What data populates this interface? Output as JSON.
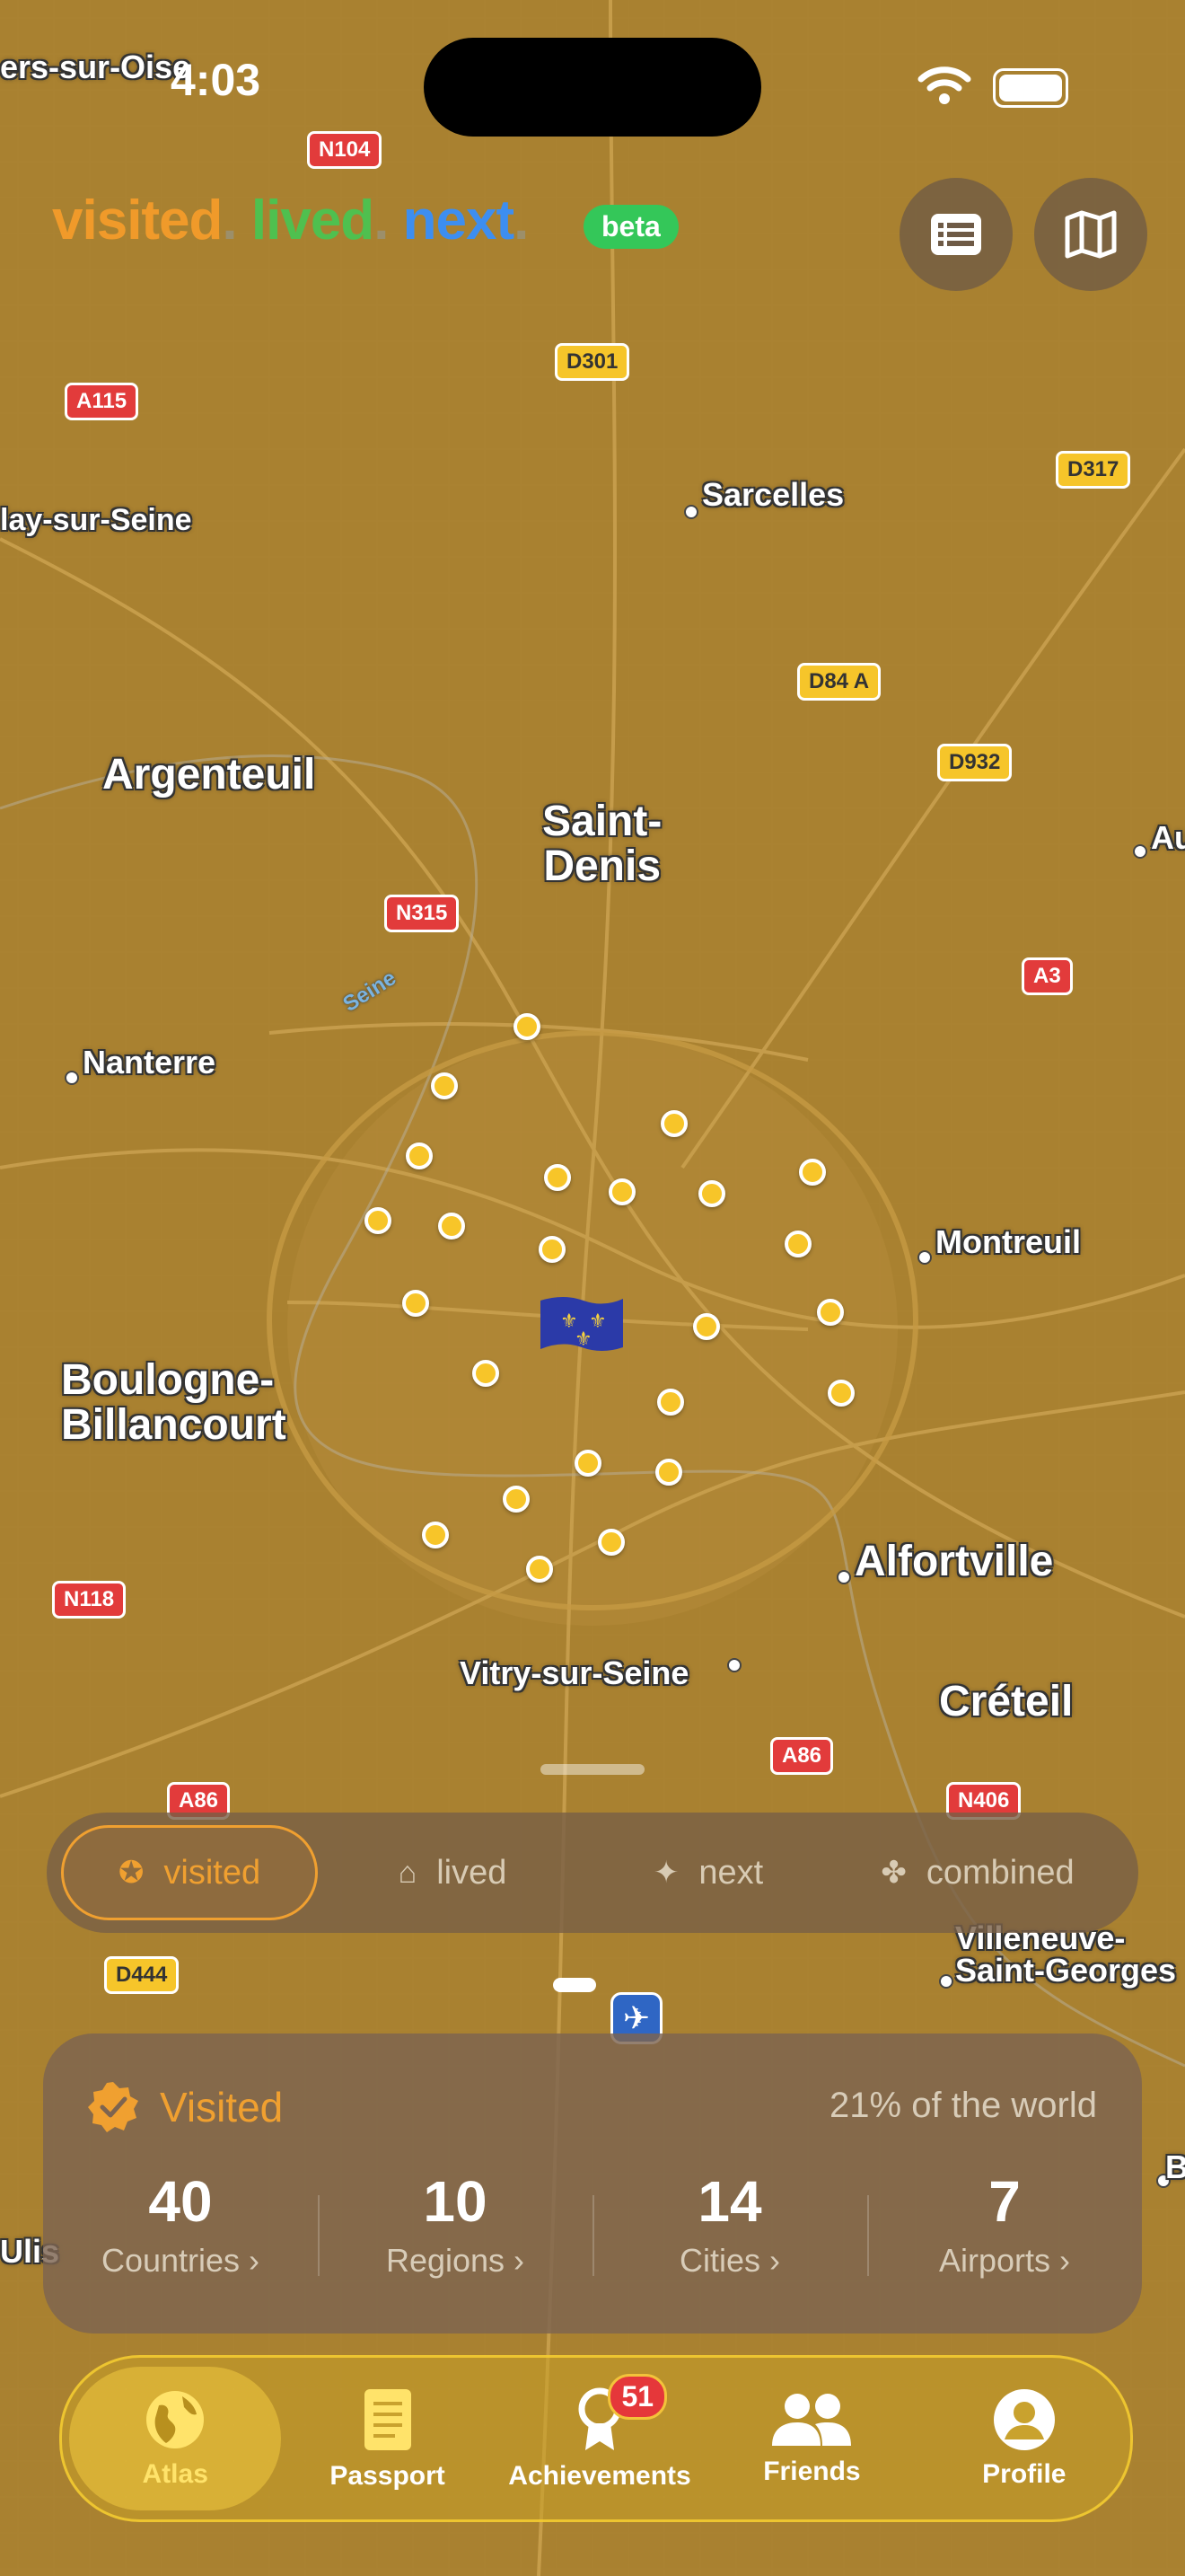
{
  "status": {
    "time": "4:03"
  },
  "logo": {
    "visited": "visited",
    "lived": "lived",
    "next": "next",
    "dot": ".",
    "beta": "beta"
  },
  "map_places": [
    {
      "name": "ers-sur-Oise"
    },
    {
      "name": "Sarcelles"
    },
    {
      "name": "lay-sur-Seine"
    },
    {
      "name": "Argenteuil"
    },
    {
      "name": "Saint-\nDenis"
    },
    {
      "name": "Au"
    },
    {
      "name": "Nanterre"
    },
    {
      "name": "Montreuil"
    },
    {
      "name": "Boulogne-\nBillancourt"
    },
    {
      "name": "Alfortville"
    },
    {
      "name": "Vitry-sur-Seine"
    },
    {
      "name": "Créteil"
    },
    {
      "name": "Villeneuve-\nSaint-Georges"
    },
    {
      "name": "Ulis"
    },
    {
      "name": "B"
    }
  ],
  "roads": [
    "N104",
    "D301",
    "A115",
    "D317",
    "D84 A",
    "D932",
    "N315",
    "A3",
    "N118",
    "A86",
    "A86",
    "N406",
    "D444"
  ],
  "river_label": "Seine",
  "segments": [
    {
      "label": "visited",
      "icon": "verified-badge-icon",
      "active": true
    },
    {
      "label": "lived",
      "icon": "house-icon",
      "active": false
    },
    {
      "label": "next",
      "icon": "sparkle-icon",
      "active": false
    },
    {
      "label": "combined",
      "icon": "clover-icon",
      "active": false
    }
  ],
  "card": {
    "title": "Visited",
    "percent": "21% of the world",
    "stats": [
      {
        "value": "40",
        "label": "Countries ›"
      },
      {
        "value": "10",
        "label": "Regions ›"
      },
      {
        "value": "14",
        "label": "Cities ›"
      },
      {
        "value": "7",
        "label": "Airports ›"
      }
    ]
  },
  "tabs": [
    {
      "label": "Atlas",
      "icon": "globe-icon",
      "active": true
    },
    {
      "label": "Passport",
      "icon": "passport-icon",
      "active": false
    },
    {
      "label": "Achievements",
      "icon": "ribbon-icon",
      "active": false,
      "badge": "51"
    },
    {
      "label": "Friends",
      "icon": "friends-icon",
      "active": false
    },
    {
      "label": "Profile",
      "icon": "profile-icon",
      "active": false
    }
  ]
}
